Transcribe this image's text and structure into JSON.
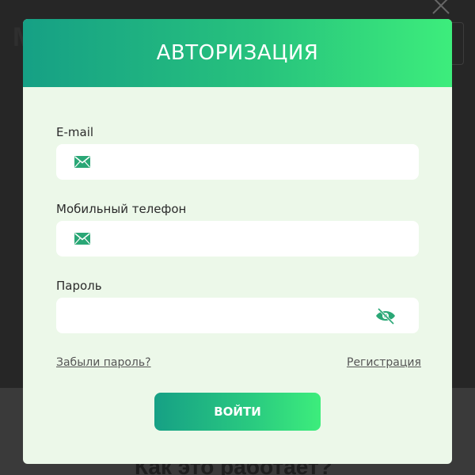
{
  "background": {
    "heading_partial": "Как это работает?"
  },
  "modal": {
    "title": "АВТОРИЗАЦИЯ",
    "accent_color": "#2acb80",
    "fields": [
      {
        "label": "E-mail",
        "value": "",
        "icon": "envelope-icon"
      },
      {
        "label": "Мобильный телефон",
        "value": "",
        "icon": "envelope-icon"
      },
      {
        "label": "Пароль",
        "value": "",
        "icon": "eye-slash-icon"
      }
    ],
    "forgot_password_link": "Забыли пароль?",
    "register_link": "Регистрация",
    "submit_label": "ВОЙТИ"
  }
}
